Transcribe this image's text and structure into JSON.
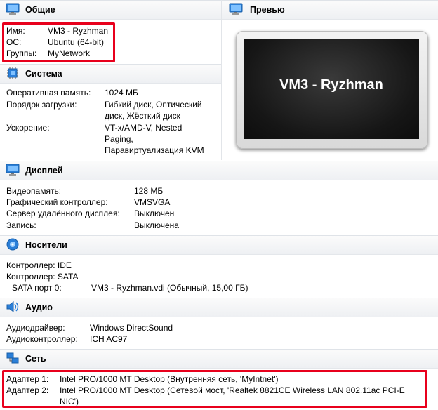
{
  "general": {
    "title": "Общие",
    "name_label": "Имя:",
    "name_value": "VM3 - Ryzhman",
    "os_label": "ОС:",
    "os_value": "Ubuntu (64-bit)",
    "groups_label": "Группы:",
    "groups_value": "MyNetwork"
  },
  "preview": {
    "title": "Превью",
    "screen_text": "VM3 - Ryzhman"
  },
  "system": {
    "title": "Система",
    "ram_label": "Оперативная память:",
    "ram_value": "1024 МБ",
    "boot_label": "Порядок загрузки:",
    "boot_value_lines": [
      "Гибкий диск, Оптический",
      "диск, Жёсткий диск"
    ],
    "accel_label": "Ускорение:",
    "accel_value_lines": [
      "VT-x/AMD-V, Nested",
      "Paging,",
      "Паравиртуализация KVM"
    ]
  },
  "display": {
    "title": "Дисплей",
    "vram_label": "Видеопамять:",
    "vram_value": "128 МБ",
    "gc_label": "Графический контроллер:",
    "gc_value": "VMSVGA",
    "rds_label": "Сервер удалённого дисплея:",
    "rds_value": "Выключен",
    "rec_label": "Запись:",
    "rec_value": "Выключена"
  },
  "storage": {
    "title": "Носители",
    "ctrl1": "Контроллер: IDE",
    "ctrl2": "Контроллер: SATA",
    "sata_port_label": "SATA порт 0:",
    "sata_port_value": "VM3 - Ryzhman.vdi (Обычный, 15,00 ГБ)"
  },
  "audio": {
    "title": "Аудио",
    "driver_label": "Аудиодрайвер:",
    "driver_value": "Windows DirectSound",
    "ctrl_label": "Аудиоконтроллер:",
    "ctrl_value": "ICH AC97"
  },
  "network": {
    "title": "Сеть",
    "a1_label": "Адаптер 1:",
    "a1_value": "Intel PRO/1000 MT Desktop (Внутренняя сеть, 'MyIntnet')",
    "a2_label": "Адаптер 2:",
    "a2_value_lines": [
      "Intel PRO/1000 MT Desktop (Сетевой мост, 'Realtek 8821CE Wireless LAN 802.11ac PCI-E",
      "NIC')"
    ]
  },
  "icons": {
    "general": "monitor-icon",
    "preview": "monitor-icon",
    "system": "chip-icon",
    "display": "monitor-icon",
    "storage": "disk-icon",
    "audio": "speaker-icon",
    "network": "network-icon"
  },
  "colors": {
    "highlight_border": "#e8001c",
    "header_bg": "#eef0f3",
    "icon_blue": "#2b7fd8"
  }
}
